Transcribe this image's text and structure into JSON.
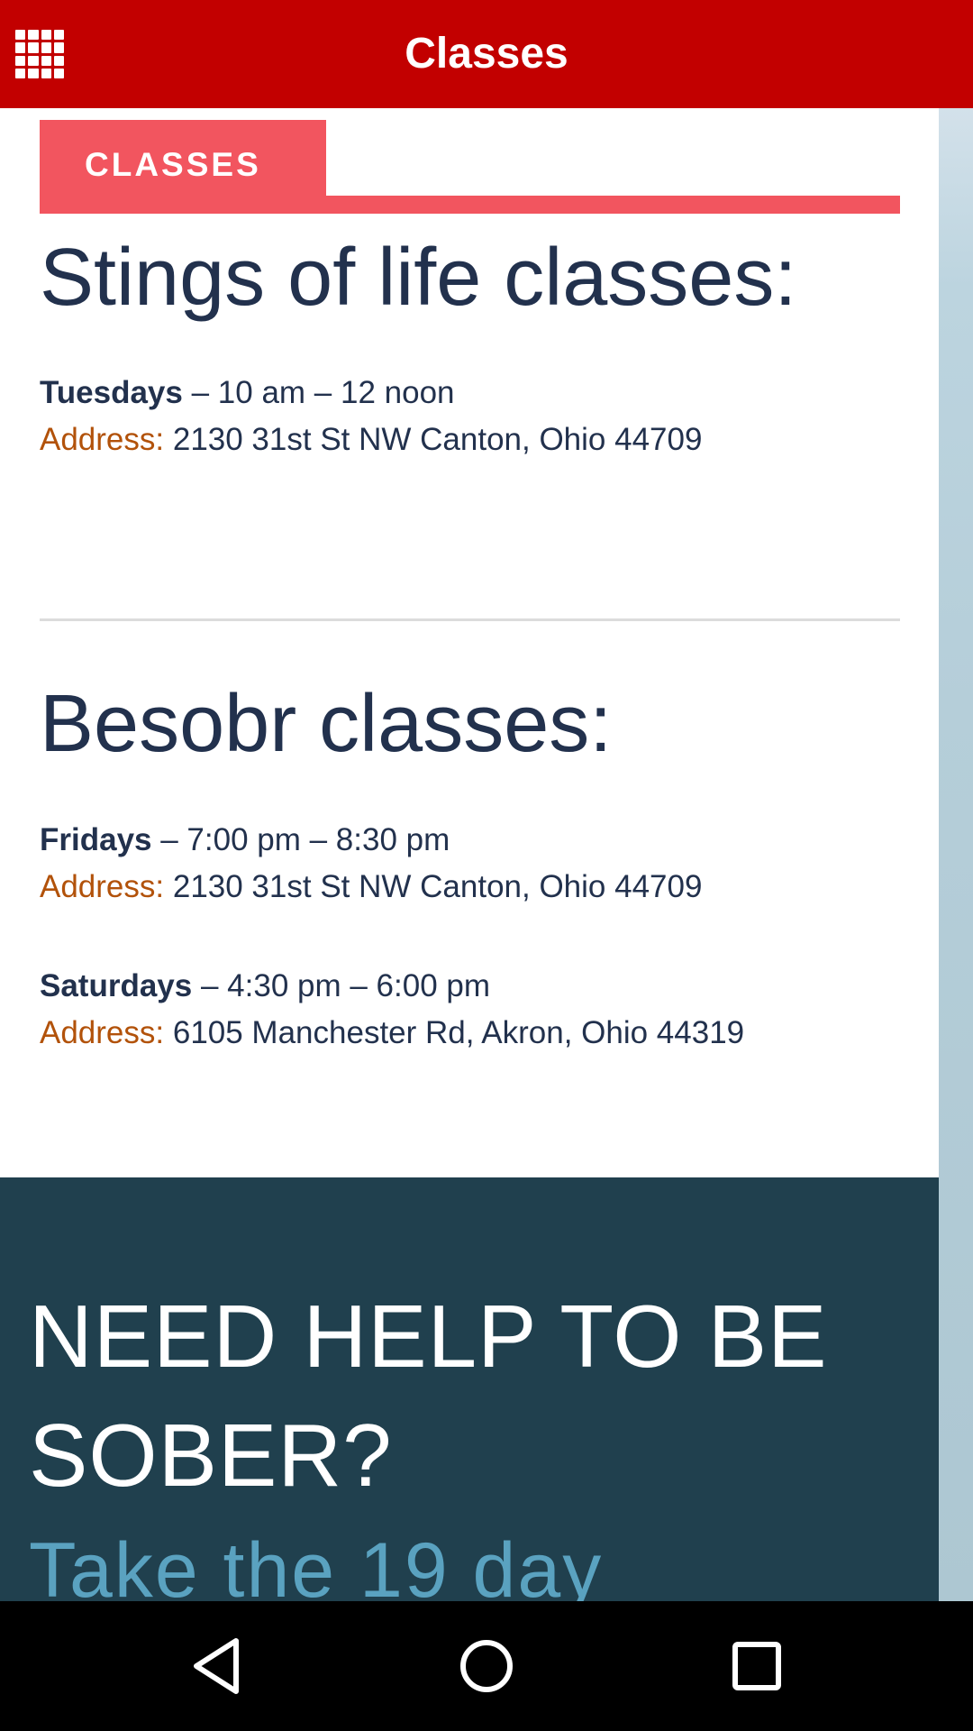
{
  "app_bar": {
    "title": "Classes",
    "menu_icon": "grid-menu-icon"
  },
  "tab": {
    "label": "CLASSES"
  },
  "sections": [
    {
      "heading": "Stings of life classes:",
      "sessions": [
        {
          "day": "Tuesdays",
          "time": " – 10 am – 12 noon",
          "address_label": "Address:",
          "address": " 2130 31st St NW Canton, Ohio 44709"
        }
      ]
    },
    {
      "heading": "Besobr classes:",
      "sessions": [
        {
          "day": "Fridays",
          "time": " – 7:00 pm – 8:30 pm",
          "address_label": "Address:",
          "address": " 2130 31st St NW Canton, Ohio 44709"
        },
        {
          "day": "Saturdays",
          "time": " – 4:30 pm – 6:00 pm",
          "address_label": "Address:",
          "address": " 6105 Manchester Rd, Akron, Ohio 44319"
        }
      ]
    }
  ],
  "cta": {
    "heading_line1": "NEED HELP TO BE",
    "heading_line2": "SOBER?",
    "subheading": "Take the 19 day"
  },
  "colors": {
    "app_bar": "#c20000",
    "tab": "#f2555f",
    "heading_text": "#22314d",
    "address_label": "#b2520a",
    "cta_background": "#20404e",
    "cta_subheading": "#5aa2c0"
  },
  "nav_bar": {
    "icons": [
      "back-icon",
      "home-icon",
      "recents-icon"
    ]
  }
}
